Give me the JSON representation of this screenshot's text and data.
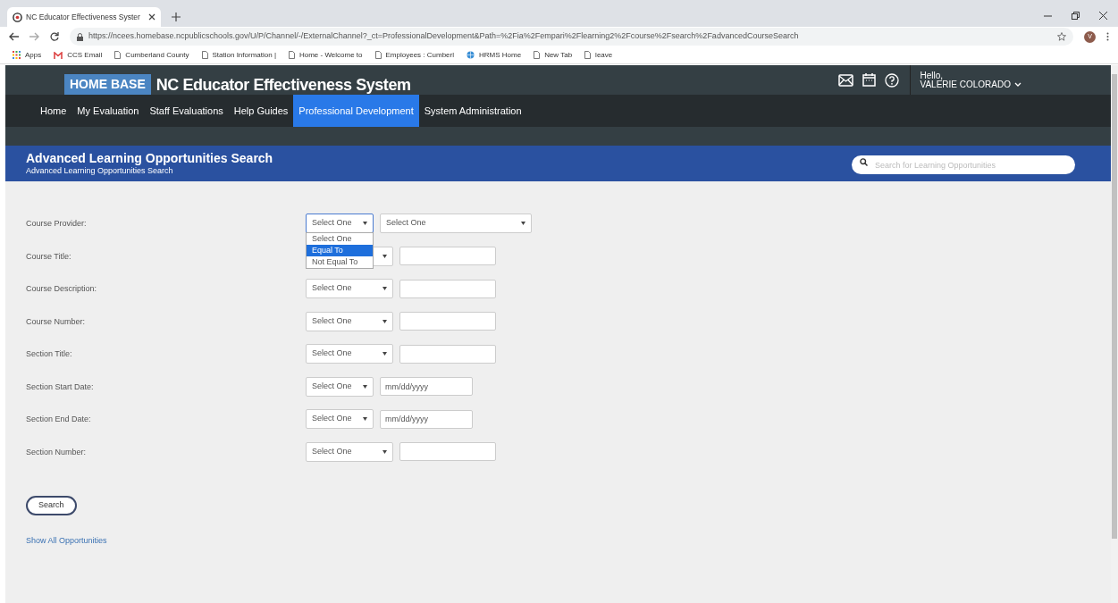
{
  "browser": {
    "tab_title": "NC Educator Effectiveness Syster",
    "address": "https://ncees.homebase.ncpublicschools.gov/U/P/Channel/-/ExternalChannel?_ct=ProfessionalDevelopment&Path=%2Fia%2Fempari%2Flearning2%2Fcourse%2Fsearch%2FadvancedCourseSearch",
    "profile_initial": "V",
    "bookmarks": [
      {
        "kind": "apps",
        "label": "Apps"
      },
      {
        "kind": "mail",
        "label": "CCS Email"
      },
      {
        "kind": "page",
        "label": "Cumberland County"
      },
      {
        "kind": "page",
        "label": "Station Information |"
      },
      {
        "kind": "page",
        "label": "Home - Welcome to"
      },
      {
        "kind": "page",
        "label": "Employees : Cumberl"
      },
      {
        "kind": "globe",
        "label": "HRMS Home"
      },
      {
        "kind": "page",
        "label": "New Tab"
      },
      {
        "kind": "page",
        "label": "leave"
      }
    ]
  },
  "header": {
    "logo": "HOME BASE",
    "title": "NC Educator Effectiveness System",
    "greeting": "Hello,",
    "user": "VALERIE COLORADO",
    "nav": [
      {
        "label": "Home",
        "selected": false
      },
      {
        "label": "My Evaluation",
        "selected": false
      },
      {
        "label": "Staff Evaluations",
        "selected": false
      },
      {
        "label": "Help Guides",
        "selected": false
      },
      {
        "label": "Professional Development",
        "selected": true
      },
      {
        "label": "System Administration",
        "selected": false
      }
    ]
  },
  "banner": {
    "title": "Advanced Learning Opportunities Search",
    "subtitle": "Advanced Learning Opportunities Search",
    "search_placeholder": "Search for Learning Opportunities"
  },
  "form": {
    "rows": [
      {
        "label": "Course Provider:",
        "operator": "Select One",
        "value": {
          "kind": "select",
          "value": "Select One"
        },
        "open": true,
        "options": [
          {
            "label": "Select One",
            "selected": false
          },
          {
            "label": "Equal To",
            "selected": true
          },
          {
            "label": "Not Equal To",
            "selected": false
          }
        ]
      },
      {
        "label": "Course Title:",
        "value": {
          "kind": "text"
        },
        "open": false
      },
      {
        "label": "Course Description:",
        "operator": "Select One",
        "value": {
          "kind": "text"
        },
        "open": false
      },
      {
        "label": "Course Number:",
        "operator": "Select One",
        "value": {
          "kind": "text"
        },
        "open": false
      },
      {
        "label": "Section Title:",
        "operator": "Select One",
        "value": {
          "kind": "text"
        },
        "open": false
      },
      {
        "label": "Section Start Date:",
        "operator": "Select One",
        "value": {
          "kind": "date",
          "placeholder": "mm/dd/yyyy"
        },
        "open": false
      },
      {
        "label": "Section End Date:",
        "operator": "Select One",
        "value": {
          "kind": "date",
          "placeholder": "mm/dd/yyyy"
        },
        "open": false
      },
      {
        "label": "Section Number:",
        "operator": "Select One",
        "value": {
          "kind": "text"
        },
        "open": false
      }
    ],
    "search_button": "Search",
    "show_all_link": "Show All Opportunities"
  }
}
